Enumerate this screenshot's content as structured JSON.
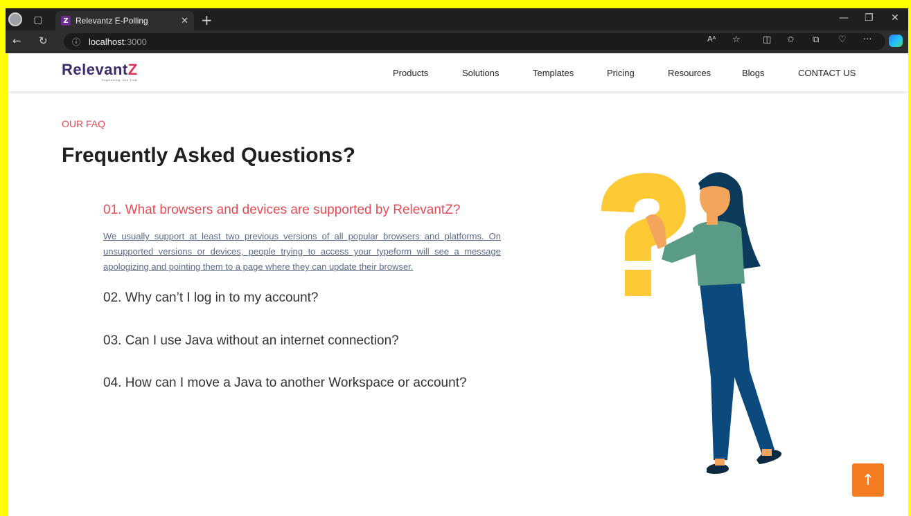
{
  "browser": {
    "tab_title": "Relevantz E-Polling",
    "tab_favicon_letter": "Z",
    "address_host": "localhost",
    "address_port": ":3000",
    "icons": [
      "profile-icon",
      "tab-actions-icon",
      "close-tab-icon",
      "new-tab-icon",
      "minimize-icon",
      "restore-icon",
      "close-window-icon",
      "back-icon",
      "refresh-icon",
      "info-icon",
      "read-aloud-icon",
      "favorite-icon",
      "split-screen-icon",
      "favorites-icon",
      "collections-icon",
      "browser-essentials-icon",
      "more-icon",
      "copilot-icon"
    ]
  },
  "nav": {
    "logo_text": "Relevant",
    "logo_z": "Z",
    "logo_tagline": "Engineering. And Trust.",
    "links": [
      "Products",
      "Solutions",
      "Templates",
      "Pricing",
      "Resources",
      "Blogs",
      "CONTACT US"
    ]
  },
  "faq": {
    "eyebrow": "OUR FAQ",
    "title": "Frequently Asked Questions?",
    "questions": [
      {
        "q": "01. What browsers and devices are supported by RelevantZ?",
        "a": "We usually support at least two previous versions of all popular browsers and platforms. On unsupported versions or devices, people trying to access your typeform will see a message apologizing and pointing them to a page where they can update their browser.",
        "expanded": true
      },
      {
        "q": "02. Why can’t I log in to my account?",
        "expanded": false
      },
      {
        "q": "03. Can I use Java without an internet connection?",
        "expanded": false
      },
      {
        "q": "04. How can I move a Java to another Workspace or account?",
        "expanded": false
      }
    ]
  },
  "colors": {
    "accent_red": "#e44c55",
    "logo_purple": "#3c2a6e",
    "logo_z_pink": "#e0305a",
    "scroll_button_orange": "#f47c20"
  },
  "scroll_top_icon": "arrow-up-icon"
}
